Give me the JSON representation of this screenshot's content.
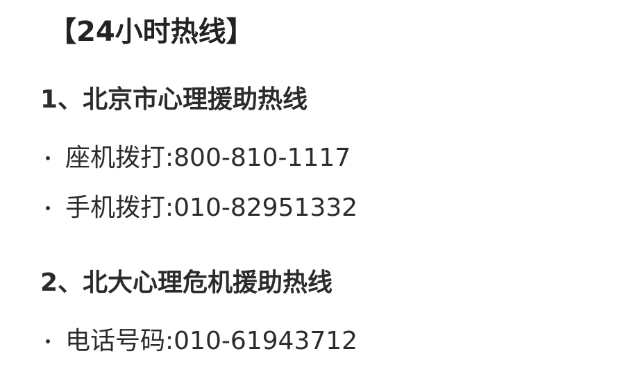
{
  "title": "【24小时热线】",
  "sections": [
    {
      "heading": "1、北京市心理援助热线",
      "items": [
        {
          "text": "座机拨打:800-810-1117"
        },
        {
          "text": "手机拨打:010-82951332"
        }
      ]
    },
    {
      "heading": "2、北大心理危机援助热线",
      "items": [
        {
          "text": "电话号码:010-61943712"
        }
      ]
    }
  ]
}
